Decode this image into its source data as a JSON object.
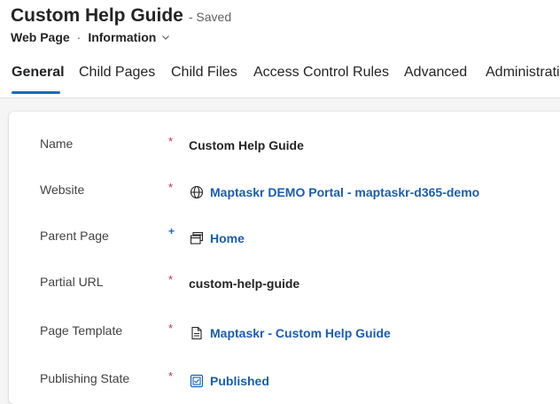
{
  "header": {
    "title": "Custom Help Guide",
    "status": "- Saved",
    "entity": "Web Page",
    "separator": "·",
    "form_name": "Information"
  },
  "tabs": [
    {
      "label": "General",
      "active": true
    },
    {
      "label": "Child Pages",
      "active": false
    },
    {
      "label": "Child Files",
      "active": false
    },
    {
      "label": "Access Control Rules",
      "active": false
    },
    {
      "label": "Advanced",
      "active": false
    },
    {
      "label": "Administration",
      "active": false
    }
  ],
  "fields": [
    {
      "label": "Name",
      "marker": "*",
      "value": "Custom Help Guide"
    },
    {
      "label": "Website",
      "marker": "*",
      "value": "Maptaskr DEMO Portal - maptaskr-d365-demo",
      "icon": "globe-icon"
    },
    {
      "label": "Parent Page",
      "marker": "+",
      "value": "Home",
      "icon": "web-page-icon"
    },
    {
      "label": "Partial URL",
      "marker": "*",
      "value": "custom-help-guide"
    },
    {
      "label": "Page Template",
      "marker": "*",
      "value": "Maptaskr - Custom Help Guide",
      "icon": "document-icon"
    },
    {
      "label": "Publishing State",
      "marker": "*",
      "value": "Published",
      "icon": "publishing-state-icon"
    }
  ],
  "colors": {
    "accent": "#0f6cbd",
    "link": "#1c5da8",
    "required": "#c4314b"
  }
}
